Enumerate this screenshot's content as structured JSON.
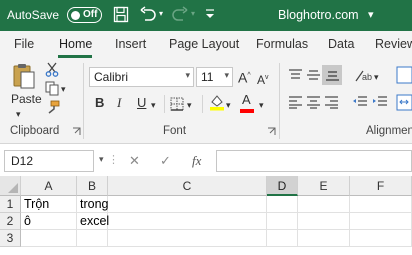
{
  "titlebar": {
    "autosave_label": "AutoSave",
    "autosave_state": "Off",
    "document_title": "Bloghotro.com",
    "title_chevron": "▾",
    "accent_color": "#217346"
  },
  "menu": {
    "tabs": [
      "File",
      "Home",
      "Insert",
      "Page Layout",
      "Formulas",
      "Data",
      "Review"
    ],
    "active": "Home"
  },
  "ribbon": {
    "clipboard": {
      "paste_label": "Paste",
      "group_label": "Clipboard"
    },
    "font": {
      "font_name": "Calibri",
      "font_size": "11",
      "bold": "B",
      "italic": "I",
      "underline": "U",
      "grow": "A",
      "shrink": "A",
      "color_letter": "A",
      "group_label": "Font",
      "highlight_color": "#ffff00",
      "font_color": "#ff0000"
    },
    "alignment": {
      "group_label": "Alignment"
    }
  },
  "formula_bar": {
    "name_box": "D12",
    "cancel": "✕",
    "enter": "✓",
    "fx": "fx",
    "value": ""
  },
  "grid": {
    "columns": [
      "A",
      "B",
      "C",
      "D",
      "E",
      "F"
    ],
    "selected_column": "D",
    "rows": [
      {
        "num": "1",
        "cells": [
          "Trộn",
          "trong",
          "",
          "",
          "",
          ""
        ]
      },
      {
        "num": "2",
        "cells": [
          "ô",
          "excel",
          "",
          "",
          "",
          ""
        ]
      },
      {
        "num": "3",
        "cells": [
          "",
          "",
          "",
          "",
          "",
          ""
        ]
      }
    ]
  }
}
